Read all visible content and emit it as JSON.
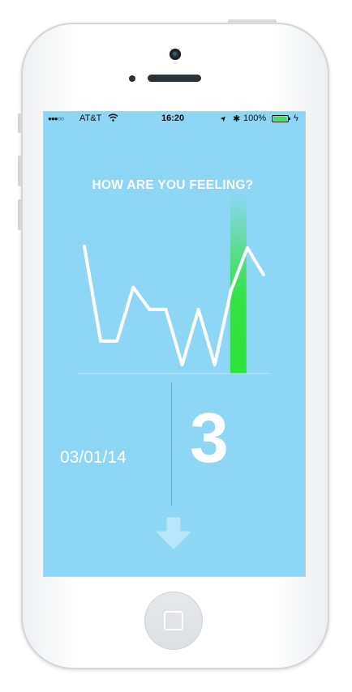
{
  "status_bar": {
    "signal": "●●●○○",
    "carrier": "AT&T",
    "wifi": "wifi-icon",
    "time": "16:20",
    "location": "➤",
    "bluetooth": "✱",
    "battery_percent": "100%",
    "charging": "ϟ"
  },
  "screen": {
    "title": "HOW ARE YOU FEELING?",
    "date": "03/01/14",
    "score": "3"
  },
  "colors": {
    "background": "#8ed6f5",
    "line": "#ffffff",
    "highlight": "#2de337",
    "battery": "#4cd964"
  },
  "chart_data": {
    "type": "line",
    "title": "HOW ARE YOU FEELING?",
    "x": [
      1,
      2,
      3,
      4,
      5,
      6,
      7,
      8,
      9,
      10,
      11,
      12
    ],
    "values": [
      7.8,
      1.8,
      1.8,
      5.2,
      3.8,
      3.8,
      0.3,
      3.8,
      0.3,
      5.0,
      7.7,
      6.0
    ],
    "highlighted_index": 10,
    "ylim": [
      0,
      8
    ],
    "grid": false,
    "baseline": true
  }
}
